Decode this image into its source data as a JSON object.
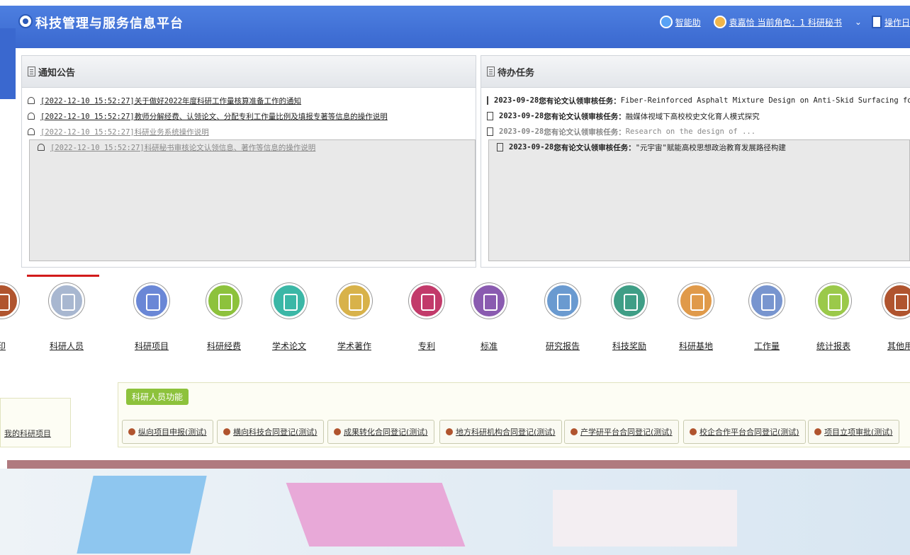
{
  "header": {
    "app_title": "科技管理与服务信息平台",
    "user_items": [
      {
        "label": "智能助"
      },
      {
        "label": "袁嘉恰 当前角色：1 科研秘书"
      },
      {
        "label": "操作日"
      }
    ],
    "caret": "⌄"
  },
  "notice_panel": {
    "title": "通知公告",
    "items": [
      "[2022-12-10 15:52:27]关于做好2022年度科研工作量核算准备工作的通知",
      "[2022-12-10 15:52:27]教师分解经费、认领论文、分配专利工作量比例及填报专著等信息的操作说明",
      "[2022-12-10 15:52:27]科研业务系统操作说明",
      "[2022-12-10 15:52:27]科研秘书审核论文认领信息、著作等信息的操作说明"
    ]
  },
  "todo_panel": {
    "title": "待办任务",
    "items": [
      {
        "date": "2023-09-28",
        "prefix": "您有论文认领审核任务：",
        "text": "Fiber-Reinforced Asphalt Mixture Design on Anti-Skid Surfacing for Field"
      },
      {
        "date": "2023-09-28",
        "prefix": "您有论文认领审核任务：",
        "text": "融媒体视域下高校校史文化育人模式探究"
      },
      {
        "date": "2023-09-28",
        "prefix": "您有论文认领审核任务：",
        "text": "Research on the design of ..."
      },
      {
        "date": "2023-09-28",
        "prefix": "您有论文认领审核任务：",
        "text": "\"元宇宙\"赋能高校思想政治教育发展路径构建"
      }
    ]
  },
  "modules": [
    {
      "label": "印",
      "color": "#b0542e"
    },
    {
      "label": "科研人员",
      "color": "#a8b7d0"
    },
    {
      "label": "科研项目",
      "color": "#6a87d6"
    },
    {
      "label": "科研经费",
      "color": "#8dc23c"
    },
    {
      "label": "学术论文",
      "color": "#3bb7a6"
    },
    {
      "label": "学术著作",
      "color": "#d8b24a"
    },
    {
      "label": "专利",
      "color": "#c23a6a"
    },
    {
      "label": "标准",
      "color": "#8a5bb0"
    },
    {
      "label": "研究报告",
      "color": "#6a9ad0"
    },
    {
      "label": "科技奖励",
      "color": "#3f9e86"
    },
    {
      "label": "科研基地",
      "color": "#e09a4a"
    },
    {
      "label": "工作量",
      "color": "#7895cf"
    },
    {
      "label": "统计报表",
      "color": "#9bc94a"
    },
    {
      "label": "其他用",
      "color": "#b0542e"
    }
  ],
  "functions": {
    "section_title": "科研人员功能",
    "left_label": "我的科研项目",
    "buttons": [
      "纵向项目申报(测试)",
      "横向科技合同登记(测试)",
      "成果转化合同登记(测试)",
      "地方科研机构合同登记(测试)",
      "产学研平台合同登记(测试)",
      "校企合作平台合同登记(测试)",
      "项目立项审批(测试)"
    ]
  }
}
